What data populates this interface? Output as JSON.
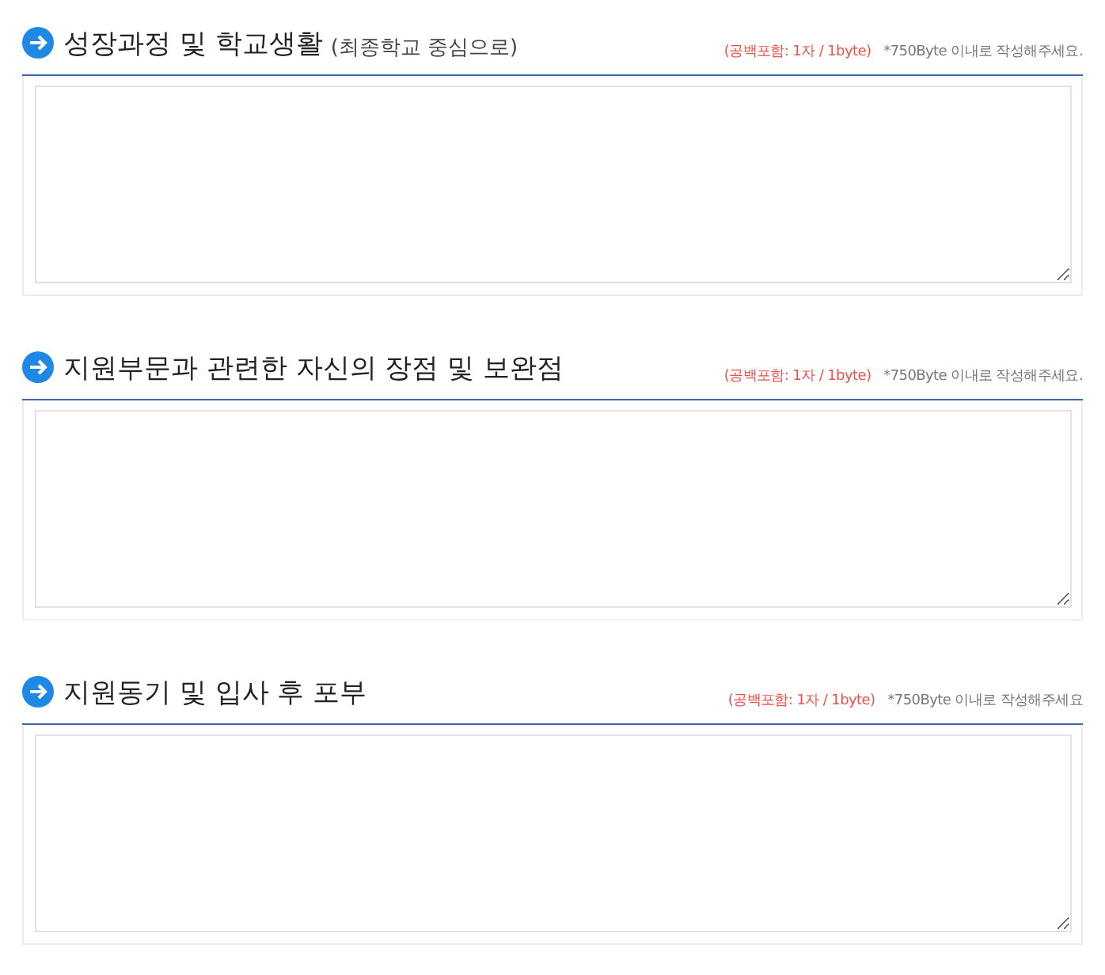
{
  "sections": [
    {
      "title": "성장과정 및 학교생활",
      "subtitle": "(최종학교 중심으로)",
      "counter": "(공백포함: 1자 / 1byte)",
      "note": "*750Byte 이내로 작성해주세요."
    },
    {
      "title": "지원부문과 관련한 자신의 장점 및 보완점",
      "counter": "(공백포함: 1자 / 1byte)",
      "note": "*750Byte 이내로 작성해주세요."
    },
    {
      "title": "지원동기 및 입사 후 포부",
      "counter": "(공백포함: 1자 / 1byte)",
      "note": "*750Byte 이내로 작성해주세요"
    }
  ]
}
